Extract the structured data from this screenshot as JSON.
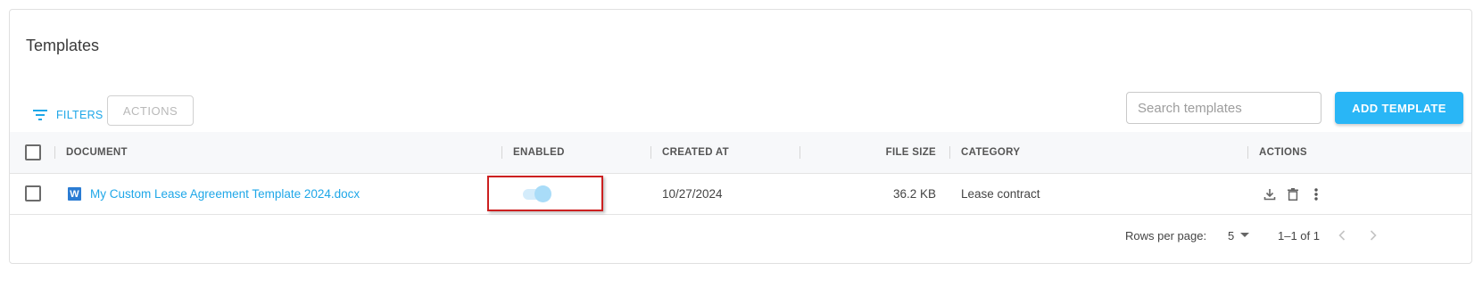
{
  "header": {
    "title": "Templates"
  },
  "toolbar": {
    "filters_label": "FILTERS",
    "actions_label": "ACTIONS",
    "search_placeholder": "Search templates",
    "add_label": "ADD TEMPLATE"
  },
  "table": {
    "columns": {
      "document": "DOCUMENT",
      "enabled": "ENABLED",
      "created_at": "CREATED AT",
      "file_size": "FILE SIZE",
      "category": "CATEGORY",
      "actions": "ACTIONS"
    },
    "rows": [
      {
        "doc_icon_letter": "W",
        "document": "My Custom Lease Agreement Template 2024.docx",
        "enabled": true,
        "created_at": "10/27/2024",
        "file_size": "36.2 KB",
        "category": "Lease contract"
      }
    ]
  },
  "pagination": {
    "rows_per_page_label": "Rows per page:",
    "rows_per_page_value": "5",
    "range": "1–1 of 1"
  },
  "colors": {
    "accent": "#29b6f6",
    "link": "#1fa7e8",
    "highlight_border": "#cc2020",
    "word_icon": "#2b7cd3"
  },
  "icons": [
    "filter-icon",
    "word-doc-icon",
    "download-icon",
    "delete-icon",
    "more-vert-icon",
    "dropdown-arrow-icon",
    "chevron-left-icon",
    "chevron-right-icon"
  ]
}
